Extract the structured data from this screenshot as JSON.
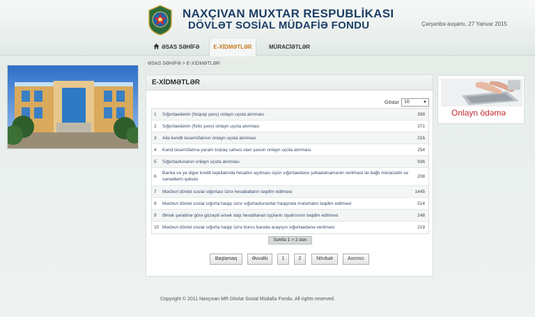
{
  "header": {
    "title_line1": "NAXÇIVAN MUXTAR RESPUBLİKASI",
    "title_line2": "DÖVLƏT SOSİAL MÜDAFİƏ FONDU",
    "date": "Çərşənbə axşamı, 27 Yanvar 2015"
  },
  "nav": {
    "home": "ƏSAS SƏHİFƏ",
    "services": "E-XİDMƏTLƏR",
    "appeals": "MÜRACİƏTLƏR"
  },
  "breadcrumb": "ƏSAS SƏHİFƏ > E-XİDMƏTLƏR",
  "panel": {
    "title": "E-XİDMƏTLƏR",
    "show_label": "Göstər",
    "show_value": "10",
    "rows": [
      {
        "num": "1",
        "name": "Sığortaedənin (hüquqi şəxs) onlayn uçota alınması",
        "count": "398"
      },
      {
        "num": "2",
        "name": "Sığortaedənin (fiziki şəxs) onlayn uçota alınması",
        "count": "371"
      },
      {
        "num": "3",
        "name": "Ailə kəndli təsərrüfatının onlayn uçota alınması",
        "count": "216"
      },
      {
        "num": "4",
        "name": "Kənd təsərrüfatına yararlı torpaq sahəsi olan şəxsin onlayn uçota alınması",
        "count": "254"
      },
      {
        "num": "5",
        "name": "Sığortaolunanın onlayn uçota alınması",
        "count": "936"
      },
      {
        "num": "6",
        "name": "Banka və ya digər kredit təşkilatında hesabın açılması üçün sığortaedənə şəhadətnamənin verilməsi ilə bağlı müraciətin və sənədlərin qəbulu",
        "count": "208"
      },
      {
        "num": "7",
        "name": "Məcburi dövlət sosial sığortası üzrə hesabatların təqdim edilməsi",
        "count": "1445"
      },
      {
        "num": "8",
        "name": "Məcburi dövlət sosial sığorta haqqı üzrə sığortaolunanlar haqqında məlumatın təqdim edilməsi",
        "count": "514"
      },
      {
        "num": "9",
        "name": "Əmək şəraitinə görə güzəştli əmək stajı hesablanan işçilərin siyahısının təqdim edilməsi",
        "count": "248"
      },
      {
        "num": "10",
        "name": "Məcburi dövlət sosial sığorta haqqı üzrə borcu barədə arayışın sığortaedənə verilməsi",
        "count": "219"
      }
    ],
    "page_info": "Səhifə 1 > 2-dən",
    "pager": {
      "first": "Başlamaq",
      "prev": "Əvvəlki",
      "page1": "1",
      "page2": "2",
      "next": "Növbəti",
      "last": "Axırıncı"
    }
  },
  "ad": {
    "text": "Onlayn ödəmə"
  },
  "footer": "Copyright © 2011 Naxçıvan MR Dövlət Sosial Müdafiə Fondu. All rights reserved."
}
